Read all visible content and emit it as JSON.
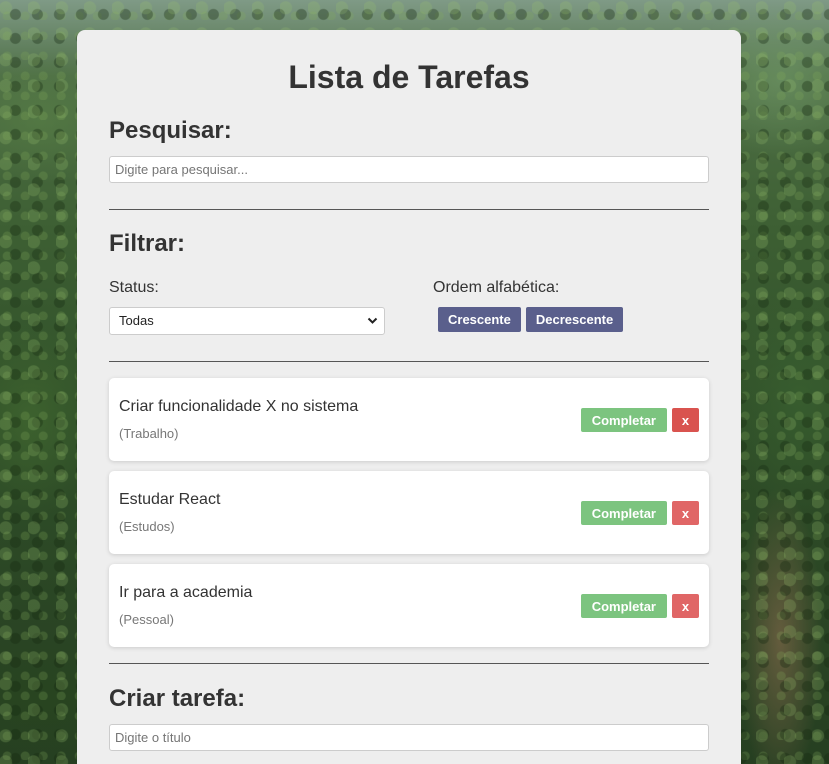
{
  "page": {
    "title": "Lista de Tarefas"
  },
  "search": {
    "heading": "Pesquisar:",
    "placeholder": "Digite para pesquisar..."
  },
  "filter": {
    "heading": "Filtrar:",
    "status_label": "Status:",
    "status_selected": "Todas",
    "order_label": "Ordem alfabética:",
    "asc_label": "Crescente",
    "desc_label": "Decrescente"
  },
  "tasks": [
    {
      "title": "Criar funcionalidade X no sistema",
      "category": "(Trabalho)",
      "complete_label": "Completar",
      "delete_label": "x"
    },
    {
      "title": "Estudar React",
      "category": "(Estudos)",
      "complete_label": "Completar",
      "delete_label": "x"
    },
    {
      "title": "Ir para a academia",
      "category": "(Pessoal)",
      "complete_label": "Completar",
      "delete_label": "x"
    }
  ],
  "create": {
    "heading": "Criar tarefa:",
    "title_placeholder": "Digite o título"
  },
  "colors": {
    "panel": "#eeeeee",
    "order_button": "#5a5f8c",
    "complete_button": "#7cc47f",
    "delete_button": "#e06666"
  }
}
